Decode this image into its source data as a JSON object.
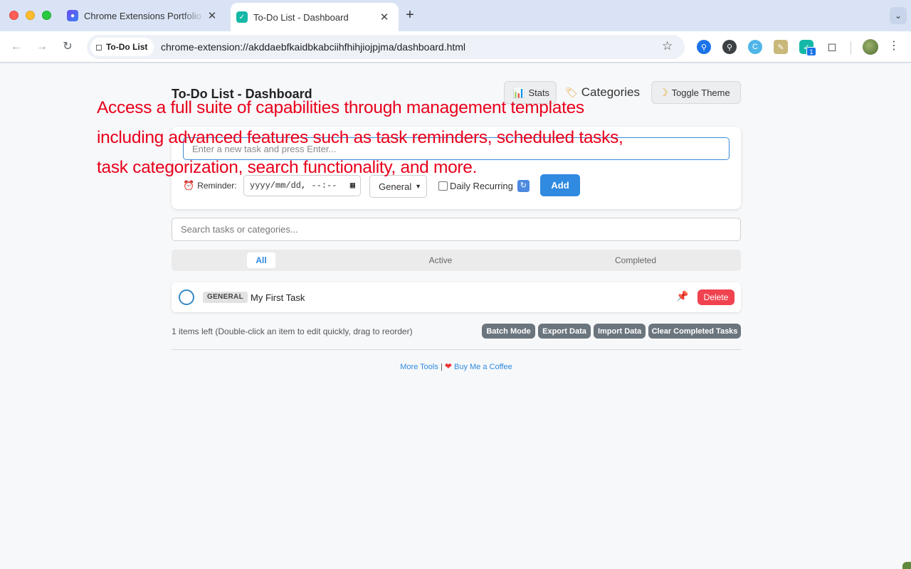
{
  "browser": {
    "tabs": [
      {
        "title": "Chrome Extensions Portfolio | ",
        "active": false
      },
      {
        "title": "To-Do List - Dashboard",
        "active": true
      }
    ],
    "address": {
      "chip_label": "To-Do List",
      "url": "chrome-extension://akddaebfkaidbkabciihfhihjiojpjma/dashboard.html"
    },
    "extension_badge": "1"
  },
  "page": {
    "title": "To-Do List - Dashboard",
    "header_buttons": {
      "stats": "Stats",
      "categories": "Categories",
      "toggle_theme": "Toggle Theme"
    },
    "add_form": {
      "task_placeholder": "Enter a new task and press Enter...",
      "reminder_label": "Reminder:",
      "datetime_placeholder": "yyyy/mm/dd, --:--",
      "category_selected": "General",
      "daily_recurring_label": "Daily Recurring",
      "daily_recurring_checked": false,
      "add_label": "Add"
    },
    "search_placeholder": "Search tasks or categories...",
    "filters": [
      {
        "label": "All",
        "selected": true
      },
      {
        "label": "Active",
        "selected": false
      },
      {
        "label": "Completed",
        "selected": false
      }
    ],
    "tasks": [
      {
        "category": "GENERAL",
        "text": "My First Task",
        "completed": false,
        "delete_label": "Delete"
      }
    ],
    "items_left_text": "1 items left (Double-click an item to edit quickly, drag to reorder)",
    "actions": {
      "batch_mode": "Batch Mode",
      "export_data": "Export Data",
      "import_data": "Import Data",
      "clear_completed": "Clear Completed Tasks"
    },
    "footer": {
      "more_tools": "More Tools",
      "separator": "|",
      "coffee": "Buy Me a Coffee"
    }
  },
  "overlay": {
    "lines": [
      "Access a full suite of capabilities through management templates",
      "including advanced features such as task reminders, scheduled tasks,",
      "task categorization, search functionality, and more."
    ],
    "color": "#e8001b"
  },
  "colors": {
    "accent": "#2f8ae0",
    "danger": "#f0434f",
    "action_gray": "#6b757d"
  }
}
